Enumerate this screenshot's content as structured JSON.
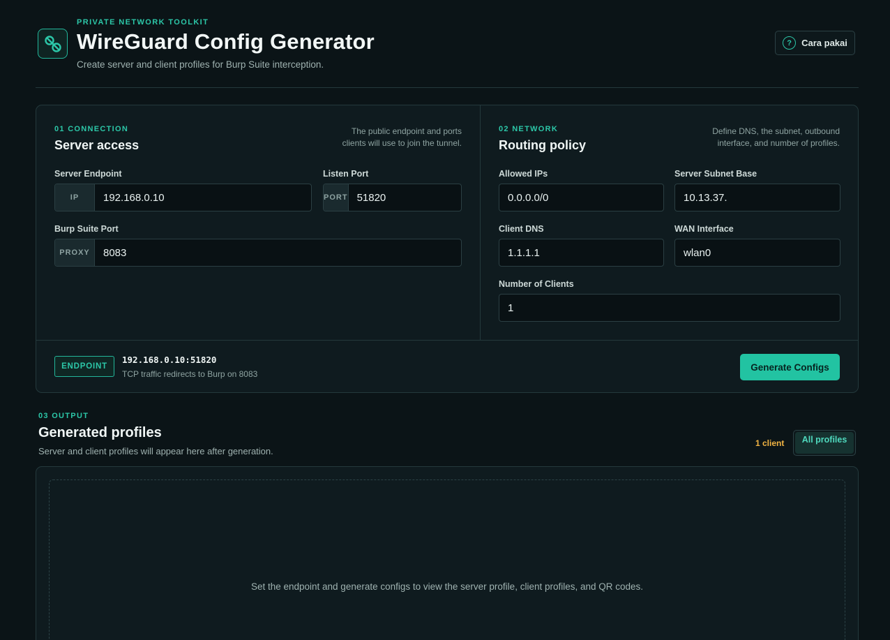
{
  "header": {
    "kicker": "PRIVATE NETWORK TOOLKIT",
    "title": "WireGuard Config Generator",
    "subtitle": "Create server and client profiles for Burp Suite interception.",
    "help_label": "Cara pakai",
    "help_icon": "question-icon",
    "logo_icon": "link-icon"
  },
  "connection": {
    "kicker": "01 CONNECTION",
    "title": "Server access",
    "desc_line1": "The public endpoint and ports",
    "desc_line2": "clients will use to join the tunnel.",
    "server_endpoint_label": "Server Endpoint",
    "server_endpoint_addon": "IP",
    "server_endpoint_value": "192.168.0.10",
    "listen_port_label": "Listen Port",
    "listen_port_addon": "PORT",
    "listen_port_value": "51820",
    "burp_port_label": "Burp Suite Port",
    "burp_port_addon": "PROXY",
    "burp_port_value": "8083"
  },
  "network": {
    "kicker": "02 NETWORK",
    "title": "Routing policy",
    "desc_line1": "Define DNS, the subnet, outbound",
    "desc_line2": "interface, and number of profiles.",
    "allowed_ips_label": "Allowed IPs",
    "allowed_ips_value": "0.0.0.0/0",
    "subnet_label": "Server Subnet Base",
    "subnet_value": "10.13.37.",
    "dns_label": "Client DNS",
    "dns_value": "1.1.1.1",
    "wan_label": "WAN Interface",
    "wan_value": "wlan0",
    "clients_label": "Number of Clients",
    "clients_value": "1"
  },
  "footer": {
    "endpoint_tag": "ENDPOINT",
    "endpoint_value": "192.168.0.10:51820",
    "endpoint_note": "TCP traffic redirects to Burp on 8083",
    "generate_label": "Generate Configs"
  },
  "output": {
    "kicker": "03 OUTPUT",
    "title": "Generated profiles",
    "desc": "Server and client profiles will appear here after generation.",
    "client_count": "1 client",
    "profiles_filter": "All profiles",
    "empty_message": "Set the endpoint and generate configs to view the server profile, client profiles, and QR codes."
  },
  "colors": {
    "accent": "#22c3a2",
    "background": "#0b1417",
    "panel": "#0f1b1f",
    "warning": "#f2b443"
  }
}
